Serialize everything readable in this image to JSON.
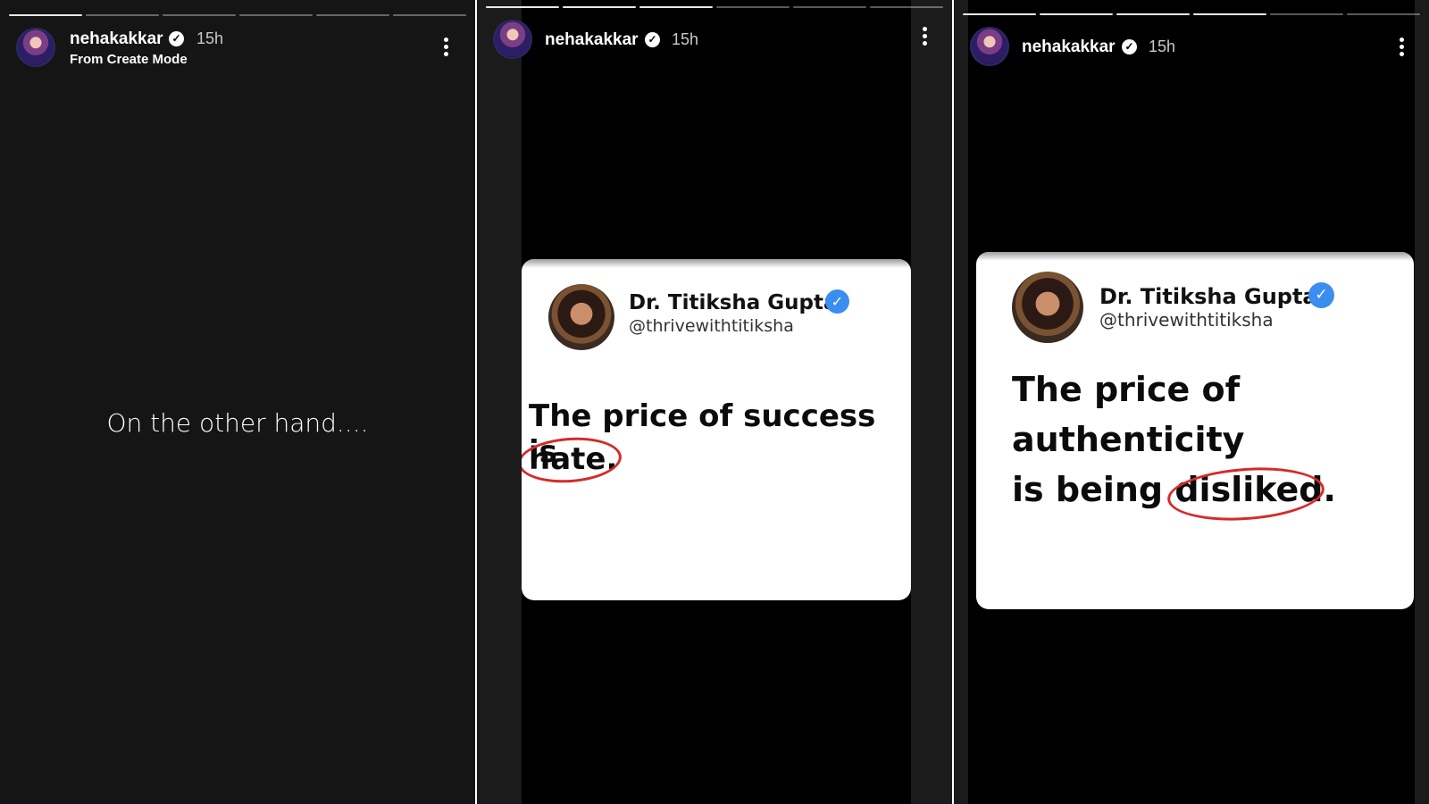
{
  "story": {
    "username": "nehakakkar",
    "verified_glyph": "✓",
    "time": "15h"
  },
  "panel1": {
    "subtitle": "From Create Mode",
    "text": "On the other hand....",
    "progress_segments": 6,
    "progress_done": 1
  },
  "card": {
    "name": "Dr. Titiksha Gupta",
    "handle": "@thrivewithtitiksha",
    "check_glyph": "✓"
  },
  "panel2": {
    "quote_line1": "The price of success is",
    "quote_circled": "hate."
  },
  "panel3": {
    "quote_line1": "The price of",
    "quote_line2": "authenticity",
    "quote_line3_prefix": "is being ",
    "quote_circled": "disliked."
  },
  "icons": {
    "more": "more-vertical-icon",
    "verified": "verified-badge-icon",
    "avatar": "profile-avatar"
  },
  "colors": {
    "panel1_bg": "#151515",
    "panel_bg": "#000000",
    "check_blue": "#3a8ef0",
    "circle_red": "#d52a2a"
  }
}
